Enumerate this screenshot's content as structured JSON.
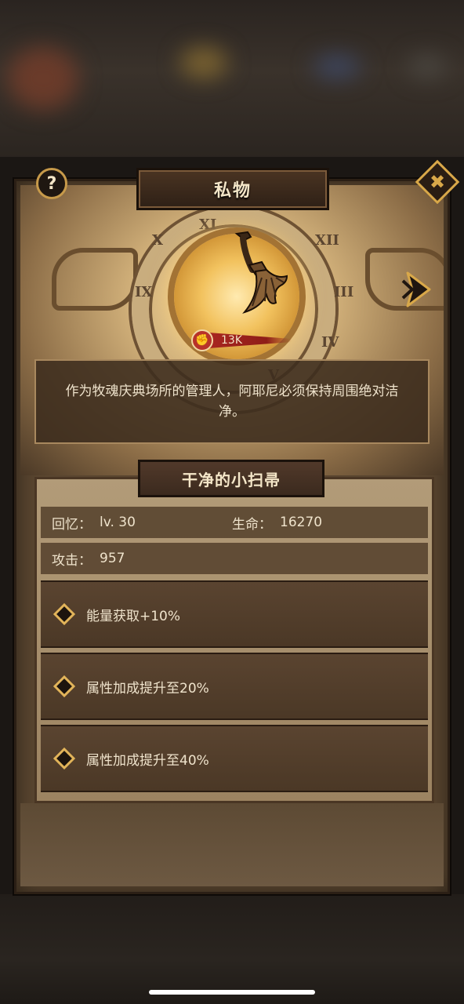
{
  "header": {
    "title": "私物",
    "help_symbol": "?",
    "close_symbol": "✖"
  },
  "item": {
    "power": "13K",
    "numerals": [
      "X",
      "XI",
      "XII",
      "IX",
      "III",
      "IV",
      "V"
    ],
    "description": "作为牧魂庆典场所的管理人，阿耶尼必须保持周围绝对洁净。",
    "name": "干净的小扫帚"
  },
  "stats": {
    "memory_label": "回忆：",
    "memory_value": "lv. 30",
    "hp_label": "生命：",
    "hp_value": "16270",
    "attack_label": "攻击：",
    "attack_value": "957"
  },
  "skills": [
    {
      "text": "能量获取+10%"
    },
    {
      "text": "属性加成提升至20%"
    },
    {
      "text": "属性加成提升至40%"
    }
  ],
  "colors": {
    "accent": "#d9a849",
    "panel": "#5a4630",
    "text": "#efe3cc"
  }
}
